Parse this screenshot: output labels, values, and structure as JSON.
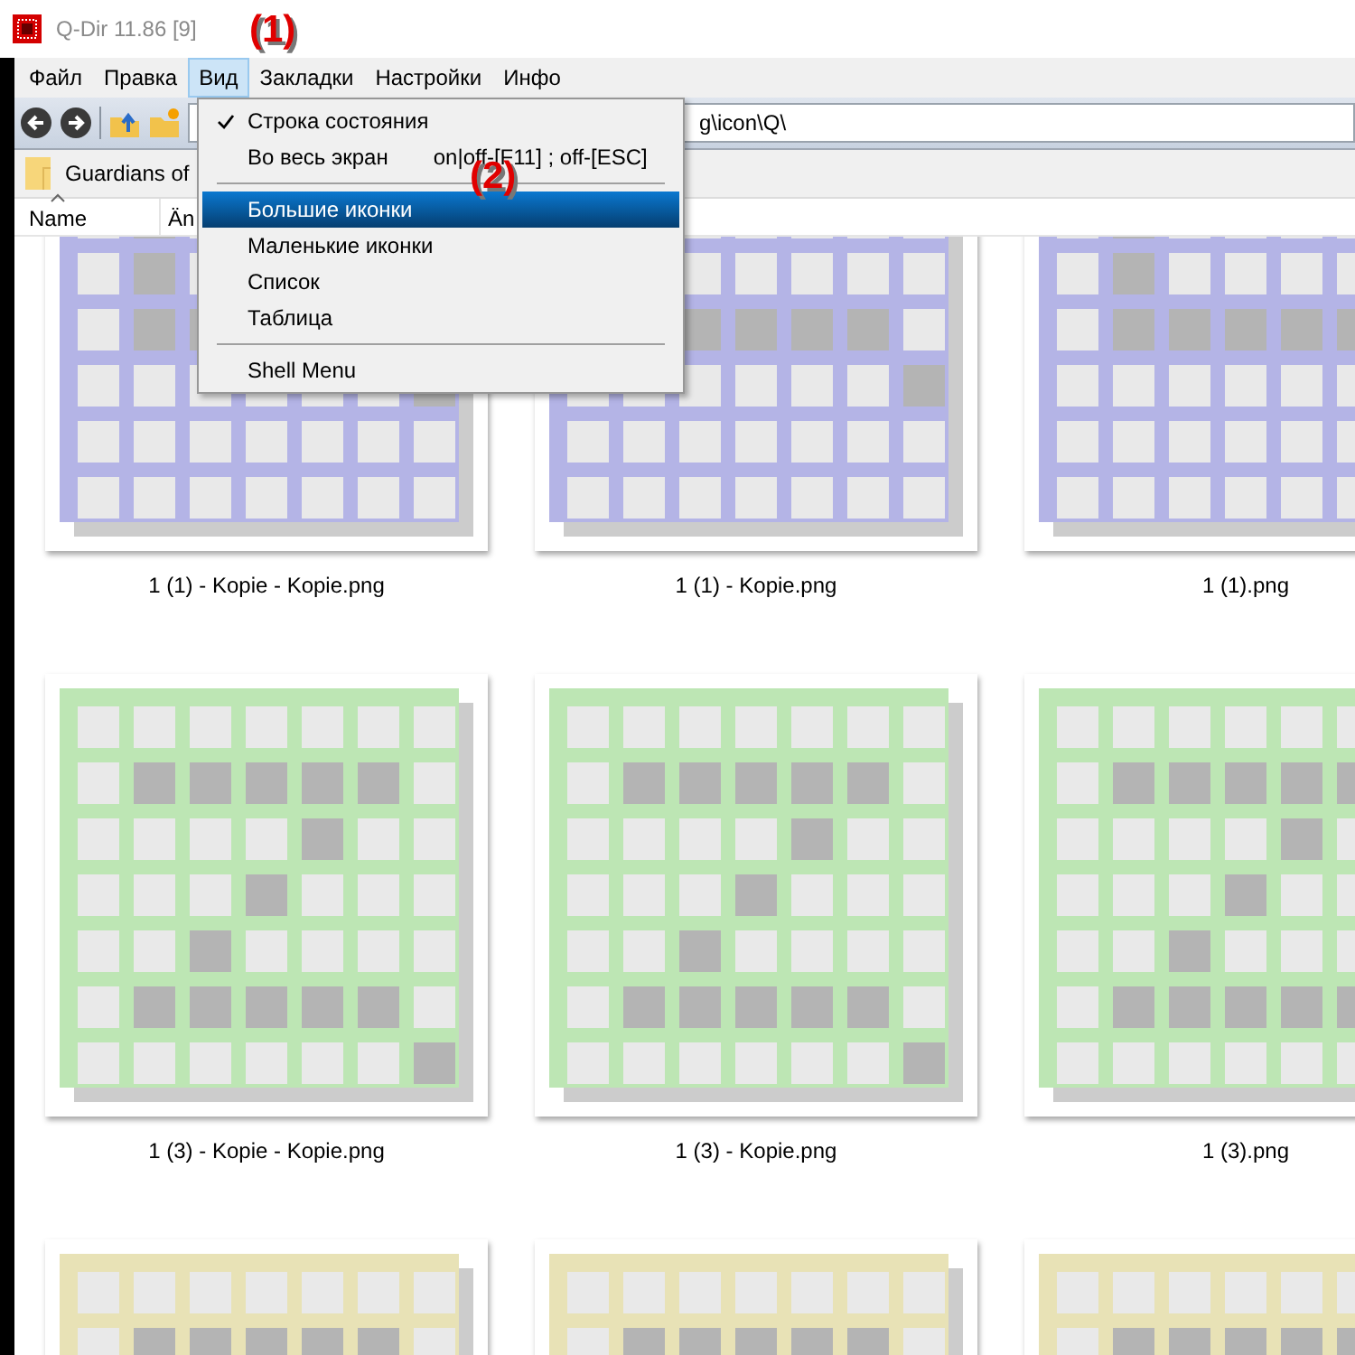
{
  "window": {
    "title": "Q-Dir 11.86 [9]"
  },
  "menu_bar": [
    {
      "label": "Файл",
      "selected": false
    },
    {
      "label": "Правка",
      "selected": false
    },
    {
      "label": "Вид",
      "selected": true
    },
    {
      "label": "Закладки",
      "selected": false
    },
    {
      "label": "Настройки",
      "selected": false
    },
    {
      "label": "Инфо",
      "selected": false
    }
  ],
  "toolbar": {
    "address": "g\\icon\\Q\\"
  },
  "bookmarks": [
    {
      "label": "Guardians of"
    }
  ],
  "columns": [
    {
      "label": "Name",
      "sorted": true
    },
    {
      "label": "Än",
      "sorted": false
    }
  ],
  "view_menu": [
    {
      "kind": "item",
      "label": "Строка состояния",
      "checked": true,
      "selected": false
    },
    {
      "kind": "item",
      "label": "Во весь экран",
      "shortcut": "on|off-[F11] ; off-[ESC]",
      "checked": false,
      "selected": false
    },
    {
      "kind": "separator"
    },
    {
      "kind": "item",
      "label": "Большие иконки",
      "checked": false,
      "selected": true
    },
    {
      "kind": "item",
      "label": "Маленькие иконки",
      "checked": false,
      "selected": false
    },
    {
      "kind": "item",
      "label": "Список",
      "checked": false,
      "selected": false
    },
    {
      "kind": "item",
      "label": "Таблица",
      "checked": false,
      "selected": false
    },
    {
      "kind": "separator"
    },
    {
      "kind": "item",
      "label": "Shell Menu",
      "checked": false,
      "selected": false
    }
  ],
  "files": [
    {
      "name": "1 (1) - Kopie - Kopie.png",
      "color": "#b4b4e6"
    },
    {
      "name": "1 (1) - Kopie.png",
      "color": "#b4b4e6"
    },
    {
      "name": "1 (1).png",
      "color": "#b4b4e6"
    },
    {
      "name": "1 (3) - Kopie - Kopie.png",
      "color": "#bde6b4"
    },
    {
      "name": "1 (3) - Kopie.png",
      "color": "#bde6b4"
    },
    {
      "name": "1 (3).png",
      "color": "#bde6b4"
    },
    {
      "color": "#e8e2b6"
    },
    {
      "color": "#e8e2b6"
    },
    {
      "color": "#e8e2b6"
    }
  ],
  "annotations": [
    {
      "label": "(1)"
    },
    {
      "label": "(2)"
    }
  ]
}
